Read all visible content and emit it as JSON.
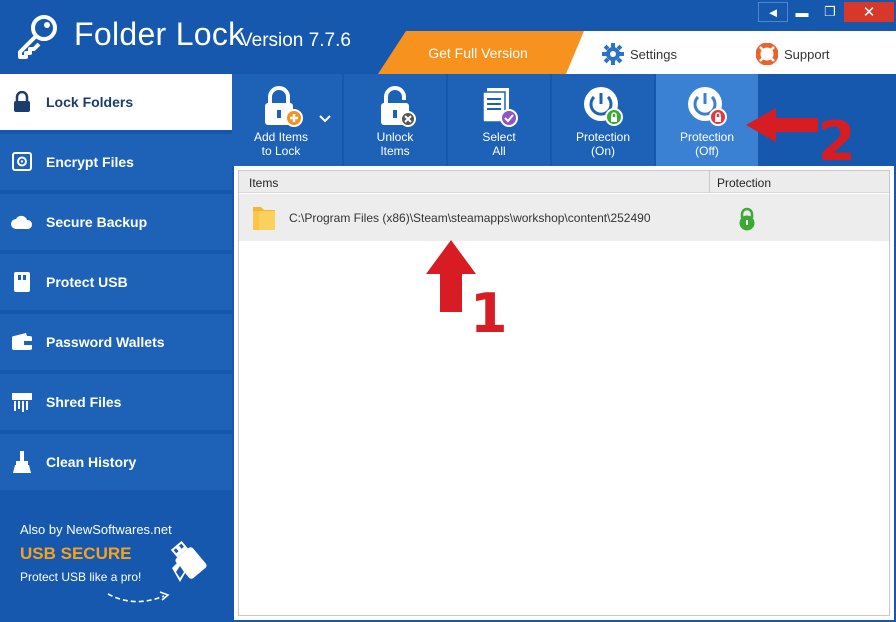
{
  "header": {
    "title": "Folder Lock",
    "version": "Version 7.7.6",
    "tabs": {
      "full_version": "Get Full Version",
      "settings": "Settings",
      "support": "Support"
    },
    "window_controls": {
      "back": "◄",
      "minimize": "▬",
      "maximize": "❐",
      "close": "✕"
    }
  },
  "sidebar": {
    "items": [
      {
        "label": "Lock Folders",
        "icon": "lock-icon",
        "active": true
      },
      {
        "label": "Encrypt Files",
        "icon": "safe-icon"
      },
      {
        "label": "Secure Backup",
        "icon": "cloud-icon"
      },
      {
        "label": "Protect USB",
        "icon": "usb-icon"
      },
      {
        "label": "Password Wallets",
        "icon": "wallet-icon"
      },
      {
        "label": "Shred Files",
        "icon": "shredder-icon"
      },
      {
        "label": "Clean History",
        "icon": "broom-icon"
      }
    ],
    "promo": {
      "also": "Also by NewSoftwares.net",
      "product": "USB SECURE",
      "tagline": "Protect USB like a pro!"
    }
  },
  "toolbar": {
    "add_items": {
      "line1": "Add Items",
      "line2": "to Lock"
    },
    "unlock_items": {
      "line1": "Unlock",
      "line2": "Items"
    },
    "select_all": {
      "line1": "Select",
      "line2": "All"
    },
    "protection_on": {
      "line1": "Protection",
      "line2": "(On)"
    },
    "protection_off": {
      "line1": "Protection",
      "line2": "(Off)"
    }
  },
  "table": {
    "columns": [
      "Items",
      "Protection"
    ],
    "rows": [
      {
        "path": "C:\\Program Files (x86)\\Steam\\steamapps\\workshop\\content\\252490",
        "protection": "locked"
      }
    ]
  },
  "annotations": {
    "marker_1": "1",
    "marker_2": "2"
  },
  "colors": {
    "brand_blue": "#1558ad",
    "accent_orange": "#f7921e",
    "annotation_red": "#d71c24",
    "lock_green": "#3aaa35"
  }
}
